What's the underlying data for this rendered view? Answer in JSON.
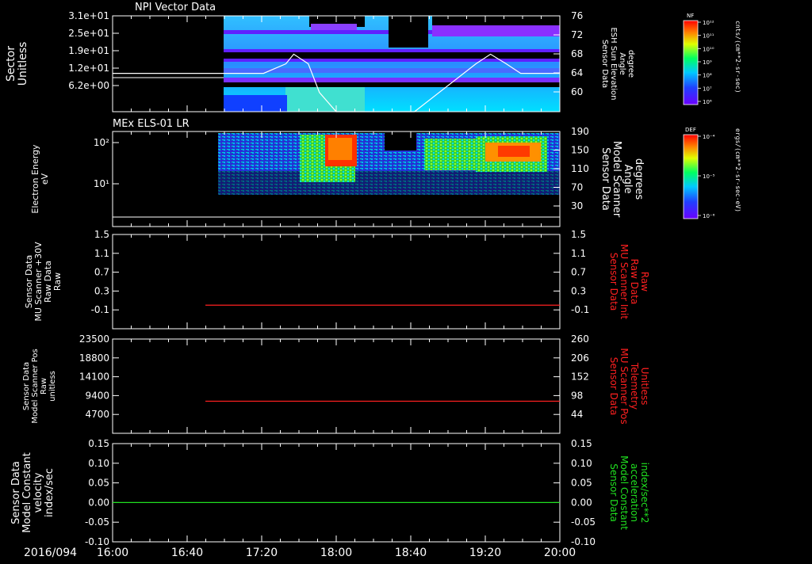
{
  "time_axis": {
    "date_label": "2016/094",
    "ticks": [
      "16:00",
      "16:40",
      "17:20",
      "18:00",
      "18:40",
      "19:20",
      "20:00"
    ],
    "range_hours": [
      16,
      20
    ]
  },
  "colors": {
    "background": "#000000",
    "axis": "#ffffff",
    "red_trace": "#ff2020",
    "green_trace": "#20e020"
  },
  "chart_data": [
    {
      "type": "heatmap",
      "title": "NPI Vector Data",
      "ylabel": "Sector\nUnitless",
      "ylabel_right": "Sensor Data\nESH Sun Elevation\nAngle\ndegree",
      "yticks": [
        "3.1e+01",
        "2.5e+01",
        "1.9e+01",
        "1.2e+01",
        "6.2e+00"
      ],
      "yticks_right": [
        "76",
        "72",
        "68",
        "64",
        "60"
      ],
      "ylim_right": [
        56,
        76
      ],
      "data_start_hour": 16.95,
      "colorbar": {
        "label": "NF",
        "units": "cnts/(cm**2-sr-sec)",
        "ticks": [
          "10^12",
          "10^11",
          "10^10",
          "10^9",
          "10^8",
          "10^7",
          "10^6"
        ]
      },
      "overlay_curve": {
        "baseline": 64,
        "x": [
          16.0,
          17.35,
          17.55,
          17.62,
          17.75,
          17.85,
          18.0,
          18.7,
          19.25,
          19.38,
          19.45,
          19.52,
          19.65,
          20.0
        ],
        "y": [
          64,
          64,
          66,
          68,
          66,
          60,
          55,
          55,
          66,
          68,
          67,
          66,
          64,
          64
        ]
      }
    },
    {
      "type": "heatmap",
      "title": "MEx ELS-01 LR",
      "ylabel": "Electron Energy\neV",
      "ylabel_right": "Sensor Data\nModel Scanner\nAngle\ndegrees",
      "yticks": [
        "10^2",
        "10^1"
      ],
      "yticks_right": [
        "190",
        "150",
        "110",
        "70",
        "30"
      ],
      "data_start_hour": 16.9,
      "baseline_y_right": 10,
      "colorbar": {
        "label": "DEF",
        "units": "ergs/(cm**2-sr-sec-eV)",
        "ticks": [
          "10^-4",
          "10^-5",
          "10^-6"
        ]
      }
    },
    {
      "type": "line",
      "ylabel": "Sensor Data\nMU Scanner +30V\nRaw Data\nRaw",
      "ylabel_right": "Sensor Data\nMU Scanner Init\nRaw Data\nRaw",
      "yticks": [
        "1.5",
        "1.1",
        "0.7",
        "0.3",
        "-0.1"
      ],
      "yticks_right": [
        "1.5",
        "1.1",
        "0.7",
        "0.3",
        "-0.1"
      ],
      "ylim": [
        -0.5,
        1.5
      ],
      "series": [
        {
          "color": "#ff2020",
          "x_start": 16.83,
          "x_end": 20.0,
          "value": 0.0
        }
      ]
    },
    {
      "type": "line",
      "ylabel": "Sensor Data\nModel Scanner Pos\nRaw\nunitless",
      "ylabel_right": "Sensor Data\nMU Scanner Pos\nTelemetry\nUnitless",
      "yticks": [
        "23500",
        "18800",
        "14100",
        "9400",
        "4700"
      ],
      "yticks_right": [
        "260",
        "206",
        "152",
        "98",
        "44"
      ],
      "ylim": [
        0,
        23500
      ],
      "series": [
        {
          "color": "#ff2020",
          "x_start": 16.83,
          "x_end": 20.0,
          "value": 8000
        }
      ]
    },
    {
      "type": "line",
      "ylabel": "Sensor Data\nModel Constant\nvelocity\nindex/sec",
      "ylabel_right": "Sensor Data\nModel Constant\nacceleration\nindex/sec**2",
      "yticks": [
        "0.15",
        "0.10",
        "0.05",
        "0.00",
        "-0.05",
        "-0.10"
      ],
      "yticks_right": [
        "0.15",
        "0.10",
        "0.05",
        "0.00",
        "-0.05",
        "-0.10"
      ],
      "ylim": [
        -0.1,
        0.15
      ],
      "series": [
        {
          "color": "#20e020",
          "x_start": 16.0,
          "x_end": 20.0,
          "value": 0.0
        }
      ]
    }
  ]
}
